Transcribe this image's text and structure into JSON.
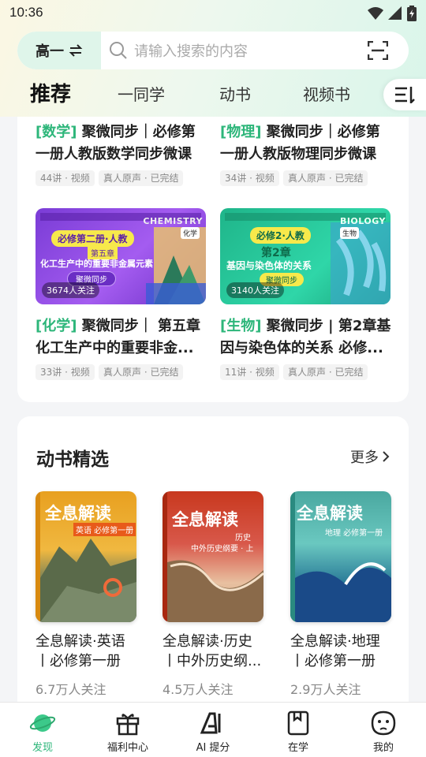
{
  "status_bar": {
    "time": "10:36"
  },
  "search": {
    "grade_label": "高一",
    "placeholder": "请输入搜索的内容"
  },
  "tabs": [
    {
      "label": "推荐",
      "active": true
    },
    {
      "label": "一同学",
      "active": false
    },
    {
      "label": "动书",
      "active": false
    },
    {
      "label": "视频书",
      "active": false
    }
  ],
  "courses": [
    {
      "subject": "[数学]",
      "title_line1": "聚微同步｜必修第",
      "title_line2": "一册人教版数学同步微课",
      "tag1": "44讲 · 视频",
      "tag2": "真人原声 · 已完结"
    },
    {
      "subject": "[物理]",
      "title_line1": "聚微同步｜必修第",
      "title_line2": "一册人教版物理同步微课",
      "tag1": "34讲 · 视频",
      "tag2": "真人原声 · 已完结"
    },
    {
      "subject": "[化学]",
      "title_line1": "聚微同步｜ 第五章",
      "title_line2": "化工生产中的重要非金...",
      "tag1": "33讲 · 视频",
      "tag2": "真人原声 · 已完结",
      "followers": "3674人关注",
      "thumb_heading": "必修第二册·人教",
      "thumb_badge": "化学",
      "thumb_chapter": "第五章",
      "thumb_topic": "化工生产中的重要非金属元素",
      "thumb_series": "聚微同步",
      "thumb_en": "CHEMISTRY"
    },
    {
      "subject": "[生物]",
      "title_line1": "聚微同步 | 第2章基",
      "title_line2": "因与染色体的关系  必修...",
      "tag1": "11讲 · 视频",
      "tag2": "真人原声 · 已完结",
      "followers": "3140人关注",
      "thumb_heading": "必修2·人教",
      "thumb_badge": "生物",
      "thumb_chapter": "第2章",
      "thumb_topic": "基因与染色体的关系",
      "thumb_series": "聚微同步",
      "thumb_en": "BIOLOGY"
    }
  ],
  "dongshu": {
    "title": "动书精选",
    "more": "更多",
    "books": [
      {
        "cover_title": "全息解读",
        "cover_sub": "英语 必修第一册",
        "title_line1": "全息解读·英语",
        "title_line2": "丨必修第一册",
        "followers": "6.7万人关注"
      },
      {
        "cover_title": "全息解读",
        "cover_sub": "历史",
        "cover_sub2": "中外历史纲要 · 上",
        "title_line1": "全息解读·历史",
        "title_line2": "丨中外历史纲...",
        "followers": "4.5万人关注"
      },
      {
        "cover_title": "全息解读",
        "cover_sub": "地理 必修第一册",
        "title_line1": "全息解读·地理",
        "title_line2": "丨必修第一册",
        "followers": "2.9万人关注"
      }
    ]
  },
  "bottom_nav": [
    {
      "label": "发现",
      "icon": "planet-icon",
      "active": true
    },
    {
      "label": "福利中心",
      "icon": "gift-icon",
      "active": false
    },
    {
      "label": "AI 提分",
      "icon": "ai-icon",
      "active": false
    },
    {
      "label": "在学",
      "icon": "book-icon",
      "active": false
    },
    {
      "label": "我的",
      "icon": "face-icon",
      "active": false
    }
  ],
  "colors": {
    "accent": "#2db67a",
    "header_bg": "#e8f7ee"
  }
}
